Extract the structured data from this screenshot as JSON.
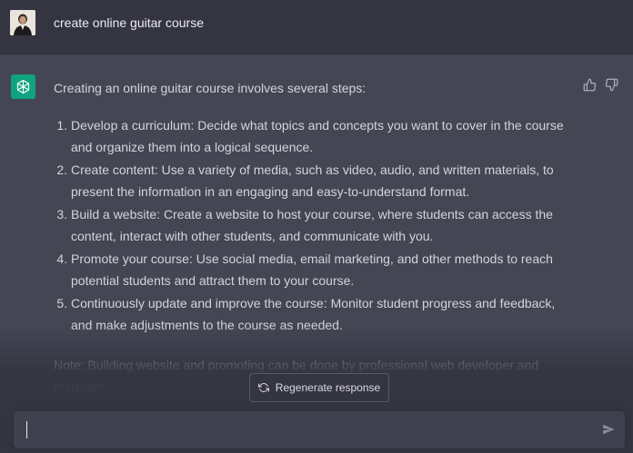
{
  "user_message": {
    "text": "create online guitar course"
  },
  "assistant_message": {
    "intro": "Creating an online guitar course involves several steps:",
    "steps": [
      "Develop a curriculum: Decide what topics and concepts you want to cover in the course and organize them into a logical sequence.",
      "Create content: Use a variety of media, such as video, audio, and written materials, to present the information in an engaging and easy-to-understand format.",
      "Build a website: Create a website to host your course, where students can access the content, interact with other students, and communicate with you.",
      "Promote your course: Use social media, email marketing, and other methods to reach potential students and attract them to your course.",
      "Continuously update and improve the course: Monitor student progress and feedback, and make adjustments to the course as needed."
    ],
    "note": "Note: Building website and promoting can be done by professional web developer and marketer."
  },
  "regenerate": {
    "label": "Regenerate response"
  },
  "composer": {
    "value": ""
  },
  "icons": {
    "bot_avatar": "openai-logo-icon",
    "thumbs_up": "thumbs-up-icon",
    "thumbs_down": "thumbs-down-icon",
    "regenerate": "refresh-icon",
    "send": "send-icon"
  },
  "colors": {
    "page_bg": "#343541",
    "assistant_bg": "#444654",
    "input_bg": "#40414f",
    "bot_avatar_bg": "#10a37f",
    "text": "#d1d5db"
  }
}
